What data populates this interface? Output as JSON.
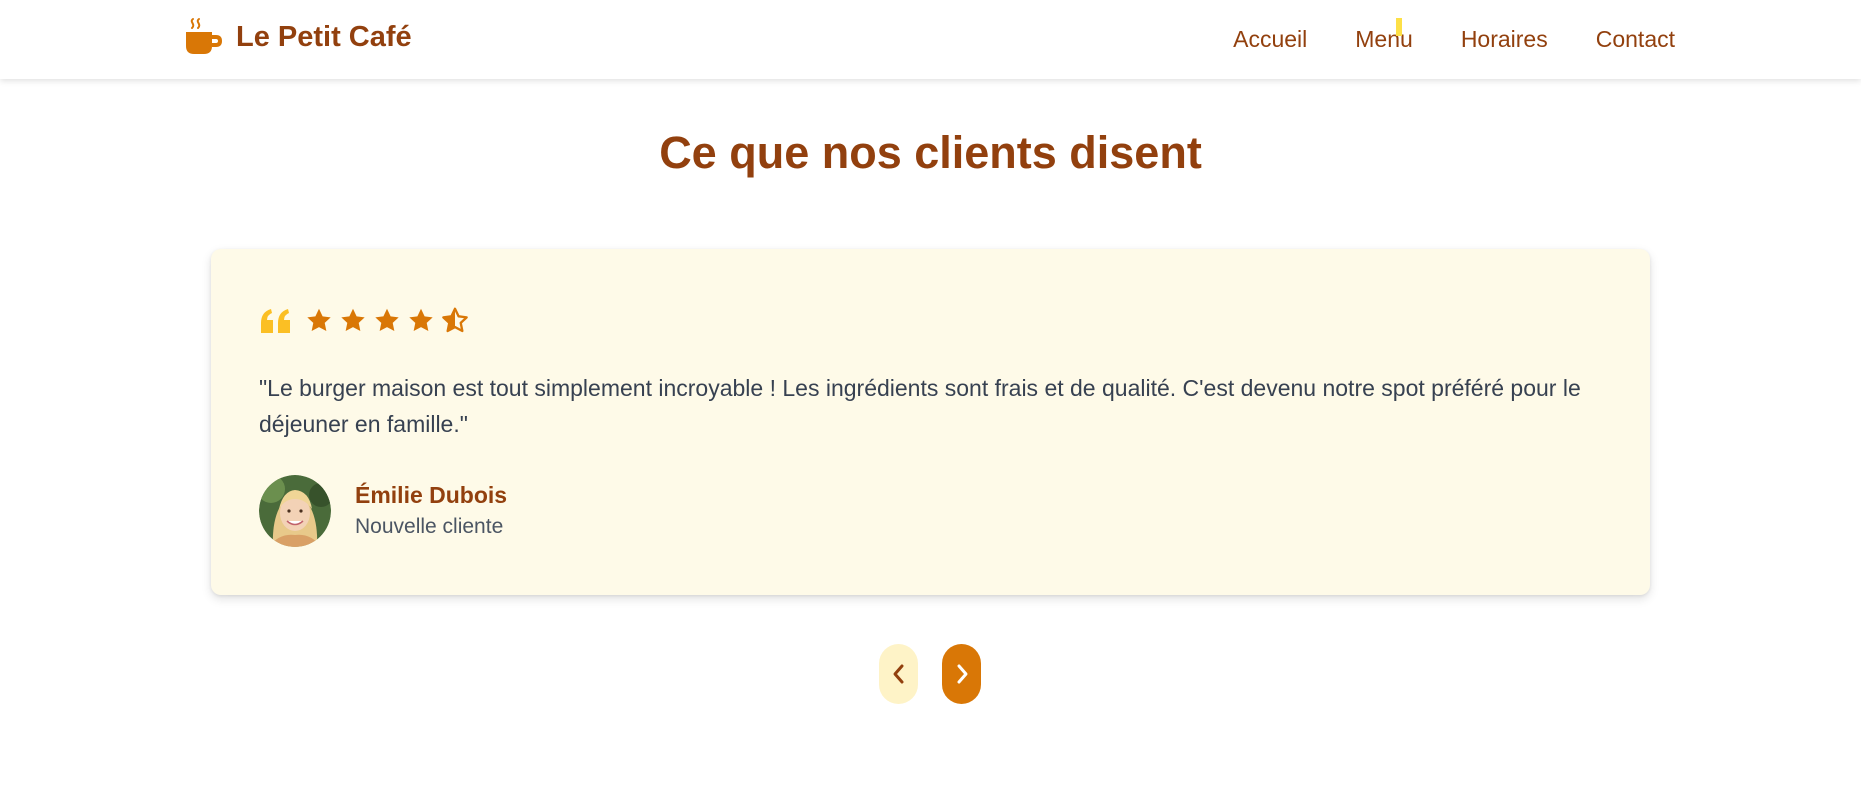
{
  "header": {
    "brand_name": "Le Petit Café",
    "brand_icon": "coffee-cup-icon",
    "nav": [
      {
        "label": "Accueil"
      },
      {
        "label": "Menu"
      },
      {
        "label": "Horaires"
      },
      {
        "label": "Contact"
      }
    ]
  },
  "testimonials": {
    "title": "Ce que nos clients disent",
    "quote_icon": "quote-icon",
    "rating": 4.5,
    "rating_max": 5,
    "review": {
      "text": "\"Le burger maison est tout simplement incroyable ! Les ingrédients sont frais et de qualité. C'est devenu notre spot préféré pour le déjeuner en famille.\"",
      "author": "Émilie Dubois",
      "author_role": "Nouvelle cliente"
    },
    "controls": {
      "prev_icon": "chevron-left-icon",
      "next_icon": "chevron-right-icon"
    }
  },
  "colors": {
    "brand": "#92400e",
    "accent": "#d97706",
    "quote": "#fbbf24",
    "card_bg": "#fefae8",
    "prev_button_bg": "#fef3c7",
    "body_text": "#374151"
  }
}
